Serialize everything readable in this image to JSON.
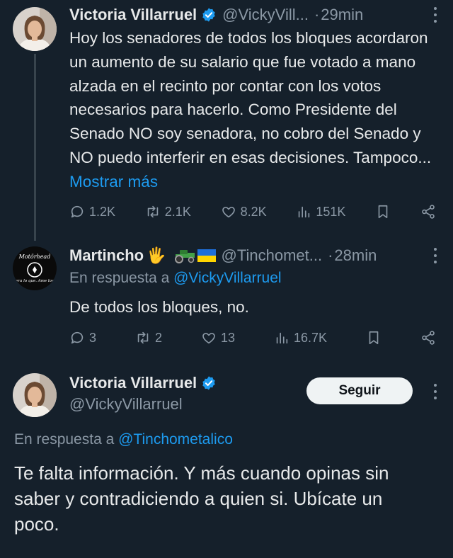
{
  "tweet1": {
    "name": "Victoria Villarruel",
    "handle": "@VickyVill...",
    "dot": "·",
    "time": "29min",
    "text": "Hoy los senadores de todos los bloques acordaron un aumento de su salario que fue votado a mano alzada en el recinto por contar con los votos necesarios para hacerlo. Como Presidente del Senado NO soy senadora, no cobro del Senado y NO puedo interferir en esas decisiones. Tampoco...",
    "show_more": "Mostrar más",
    "stats": {
      "replies": "1.2K",
      "retweets": "2.1K",
      "likes": "8.2K",
      "views": "151K"
    }
  },
  "tweet2": {
    "name": "Martincho",
    "name_emoji": "🖐",
    "handle": "@Tinchomet...",
    "dot": "·",
    "time": "28min",
    "reply_prefix": "En respuesta a",
    "reply_to": "@VickyVillarruel",
    "text": "De todos los bloques, no.",
    "avatar_text_top": "Motörhead",
    "avatar_text_bottom": "era lo que. Ame los",
    "stats": {
      "replies": "3",
      "retweets": "2",
      "likes": "13",
      "views": "16.7K"
    }
  },
  "tweet3": {
    "name": "Victoria Villarruel",
    "handle": "@VickyVillarruel",
    "follow_label": "Seguir",
    "reply_prefix": "En respuesta a",
    "reply_to": "@Tinchometalico",
    "text": "Te falta información. Y más cuando opinas sin saber y contradiciendo a quien si. Ubícate un poco."
  },
  "colors": {
    "background": "#15202b",
    "text": "#e7e9ea",
    "muted": "#8b98a5",
    "link": "#1d9bf0",
    "verified": "#1d9bf0"
  }
}
